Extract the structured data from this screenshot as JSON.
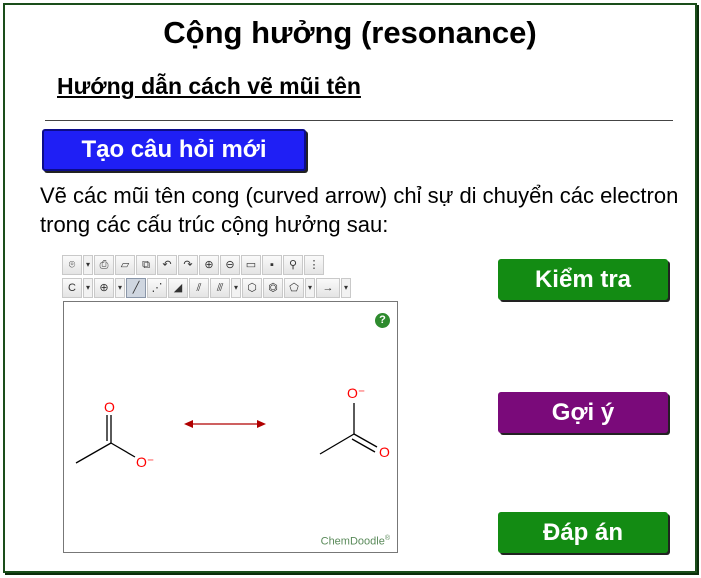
{
  "header": {
    "title": "Cộng hưởng (resonance)",
    "subtitle": "Hướng dẫn cách vẽ mũi tên"
  },
  "actions": {
    "new_question": "Tạo câu hỏi mới",
    "check": "Kiểm tra",
    "hint": "Gợi ý",
    "answer": "Đáp án"
  },
  "instructions": "Vẽ các mũi tên cong (curved arrow) chỉ sự di chuyển các electron trong các cấu trúc cộng hưởng sau:",
  "editor": {
    "toolbar_row1": [
      "lasso-icon",
      "clear-icon",
      "eraser-icon",
      "copy-icon",
      "undo-icon",
      "redo-icon",
      "zoom-in-icon",
      "zoom-out-icon",
      "open-icon",
      "save-icon",
      "search-icon",
      "settings-icon"
    ],
    "toolbar_row2": [
      "C",
      "plus-circle",
      "single-bond",
      "dashed-bond",
      "wedge-bond",
      "double-bond",
      "triple-bond",
      "cyclohexane",
      "benzene",
      "cyclopentane",
      "arrow"
    ],
    "help": "?",
    "brand": "ChemDoodle",
    "brand_mark": "®",
    "molecule_left": {
      "atoms": [
        "O",
        "O⁻"
      ]
    },
    "molecule_right": {
      "atoms": [
        "O⁻",
        "O"
      ]
    },
    "atom_color": "#ff0000",
    "resonance_arrow_color": "#b00000"
  }
}
